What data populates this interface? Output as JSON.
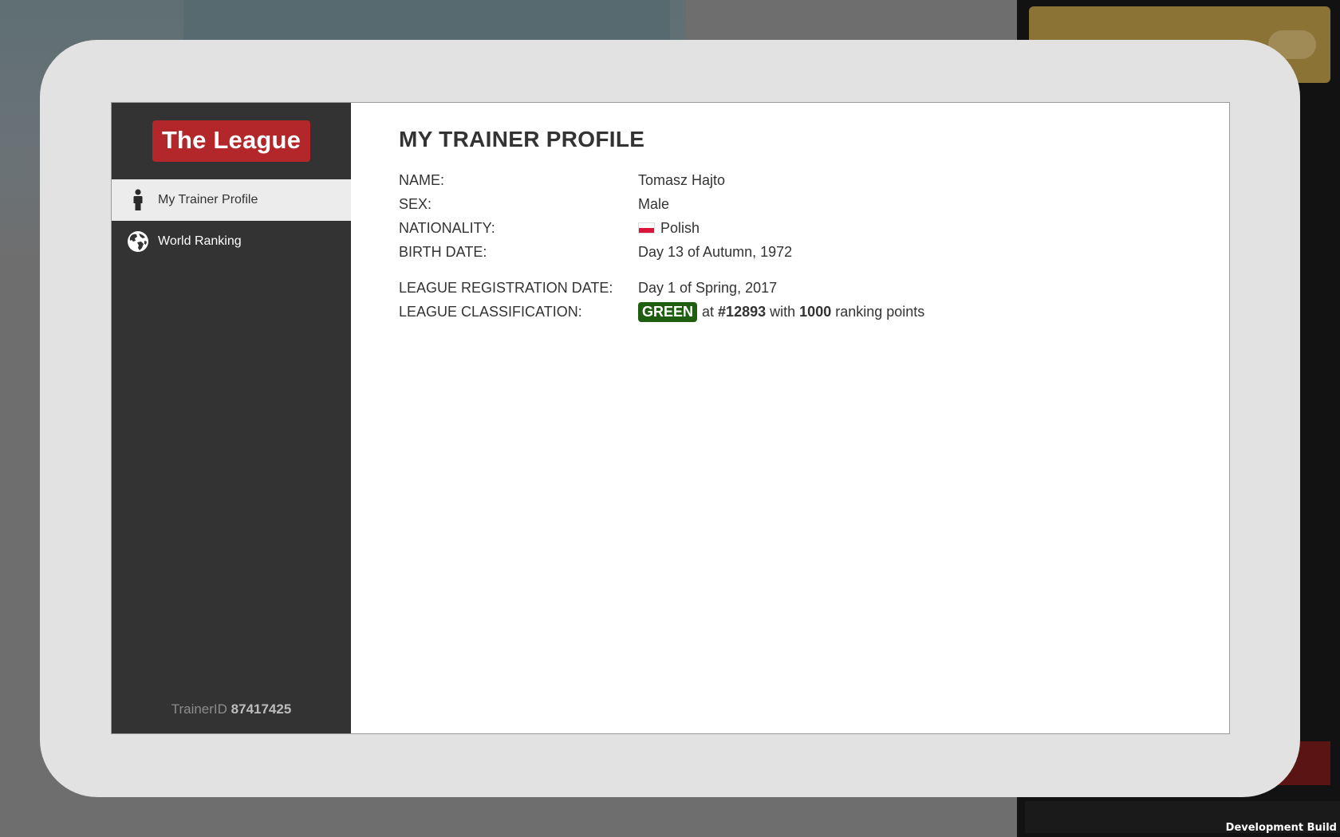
{
  "sidebar": {
    "logo": "The League",
    "items": [
      {
        "label": "My Trainer Profile",
        "icon": "person-icon",
        "active": true
      },
      {
        "label": "World Ranking",
        "icon": "globe-icon",
        "active": false
      }
    ],
    "trainer_id_label": "TrainerID",
    "trainer_id_value": "87417425"
  },
  "profile": {
    "title": "MY TRAINER PROFILE",
    "name_label": "NAME:",
    "name_value": "Tomasz Hajto",
    "sex_label": "SEX:",
    "sex_value": "Male",
    "nationality_label": "NATIONALITY:",
    "nationality_value": "Polish",
    "birth_label": "BIRTH DATE:",
    "birth_value": "Day 13 of Autumn, 1972",
    "registration_label": "LEAGUE REGISTRATION DATE:",
    "registration_value": "Day 1 of Spring, 2017",
    "classification_label": "LEAGUE CLASSIFICATION:",
    "classification_badge": "GREEN",
    "classification_at": "at",
    "classification_rank": "#12893",
    "classification_with": "with",
    "classification_points": "1000",
    "classification_suffix": "ranking points"
  },
  "footer": {
    "dev_build": "Development Build"
  },
  "colors": {
    "logo_bg": "#b3262a",
    "sidebar_bg": "#333333",
    "badge_green": "#1f5d10",
    "frame_bg": "#e2e2e2"
  }
}
